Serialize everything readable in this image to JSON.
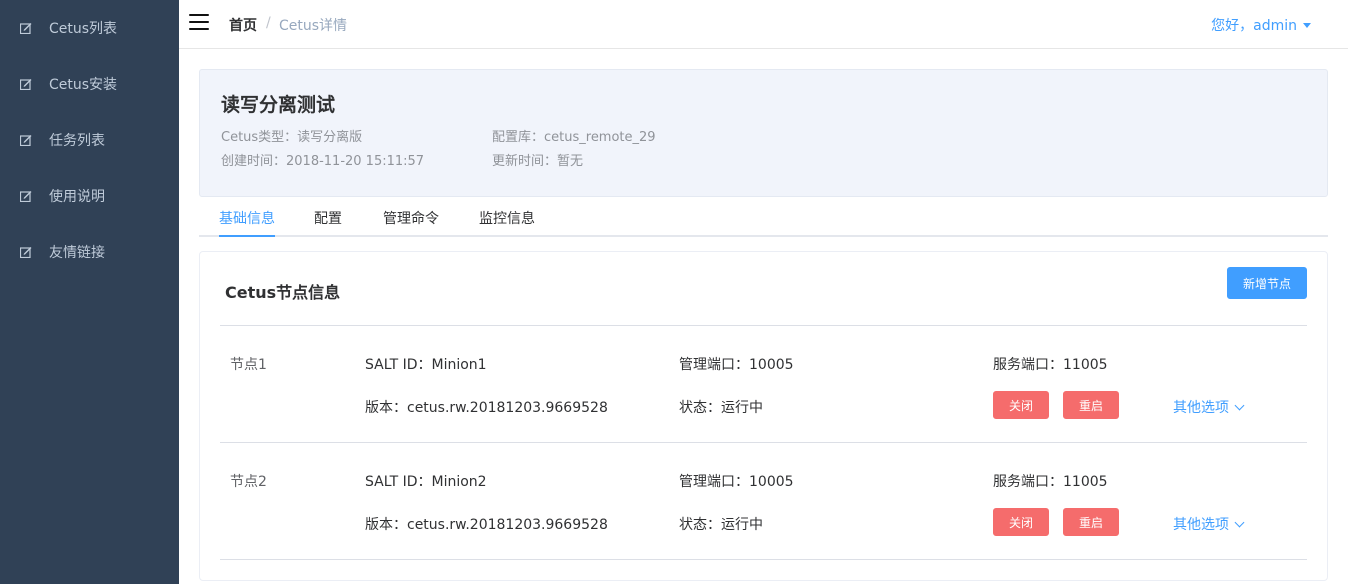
{
  "sidebar": {
    "items": [
      {
        "label": "Cetus列表",
        "icon": "edit-icon"
      },
      {
        "label": "Cetus安装",
        "icon": "edit-icon"
      },
      {
        "label": "任务列表",
        "icon": "edit-icon"
      },
      {
        "label": "使用说明",
        "icon": "edit-icon"
      },
      {
        "label": "友情链接",
        "icon": "edit-icon"
      }
    ]
  },
  "header": {
    "breadcrumb_home": "首页",
    "breadcrumb_separator": "/",
    "breadcrumb_current": "Cetus详情",
    "user_greeting": "您好，admin"
  },
  "info": {
    "title": "读写分离测试",
    "type": "Cetus类型：读写分离版",
    "config_db": "配置库：cetus_remote_29",
    "created": "创建时间：2018-11-20 15:11:57",
    "updated": "更新时间：暂无"
  },
  "tabs": [
    {
      "label": "基础信息",
      "active": true
    },
    {
      "label": "配置",
      "active": false
    },
    {
      "label": "管理命令",
      "active": false
    },
    {
      "label": "监控信息",
      "active": false
    }
  ],
  "nodes_card": {
    "title": "Cetus节点信息",
    "add_button": "新增节点",
    "nodes": [
      {
        "name": "节点1",
        "salt_id": "SALT ID：Minion1",
        "admin_port": "管理端口：10005",
        "service_port": "服务端口：11005",
        "version": "版本：cetus.rw.20181203.9669528",
        "status": "状态：运行中",
        "close_button": "关闭",
        "restart_button": "重启",
        "more_options": "其他选项"
      },
      {
        "name": "节点2",
        "salt_id": "SALT ID：Minion2",
        "admin_port": "管理端口：10005",
        "service_port": "服务端口：11005",
        "version": "版本：cetus.rw.20181203.9669528",
        "status": "状态：运行中",
        "close_button": "关闭",
        "restart_button": "重启",
        "more_options": "其他选项"
      }
    ]
  },
  "colors": {
    "sidebar_bg": "#304156",
    "accent": "#409eff",
    "danger": "#f56c6c",
    "info_panel_bg": "#f1f4fb"
  }
}
